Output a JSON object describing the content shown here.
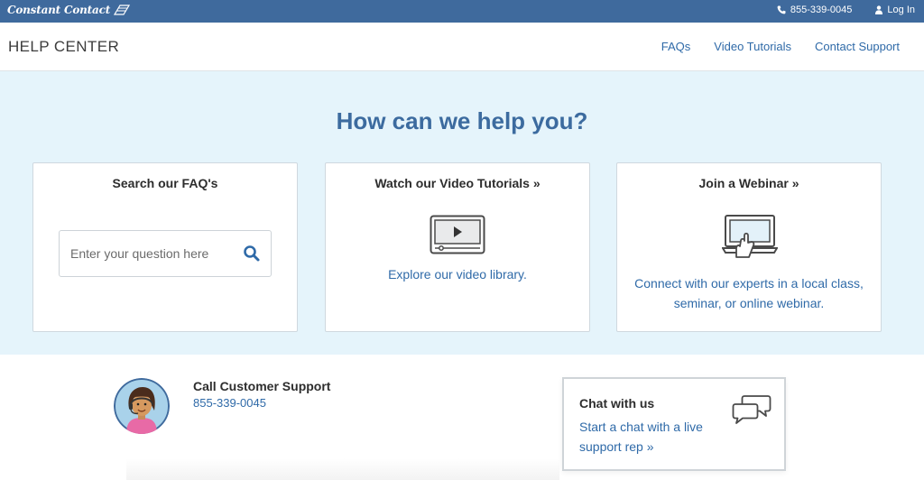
{
  "topbar": {
    "logo_text": "Constant Contact",
    "phone": "855-339-0045",
    "login_label": "Log In"
  },
  "header": {
    "title": "HELP CENTER",
    "nav": [
      "FAQs",
      "Video Tutorials",
      "Contact Support"
    ]
  },
  "hero": {
    "title": "How can we help you?",
    "cards": [
      {
        "title": "Search our FAQ's",
        "search_placeholder": "Enter your question here"
      },
      {
        "title": "Watch our Video Tutorials »",
        "link": "Explore our video library."
      },
      {
        "title": "Join a Webinar »",
        "link_line1": "Connect with our experts in a local class,",
        "link_line2": "seminar, or online webinar."
      }
    ]
  },
  "support": {
    "call_title": "Call Customer Support",
    "call_phone": "855-339-0045",
    "chat_title": "Chat with us",
    "chat_line1": "Start a chat with a live",
    "chat_line2": "support rep »"
  },
  "colors": {
    "topbar": "#3f6a9d",
    "hero_bg": "#e5f4fb",
    "link": "#2f6aa8",
    "hero_title": "#3c6b9f"
  },
  "icons": [
    "phone-icon",
    "user-icon",
    "search-icon",
    "video-player-icon",
    "webinar-laptop-icon",
    "chat-bubbles-icon"
  ]
}
